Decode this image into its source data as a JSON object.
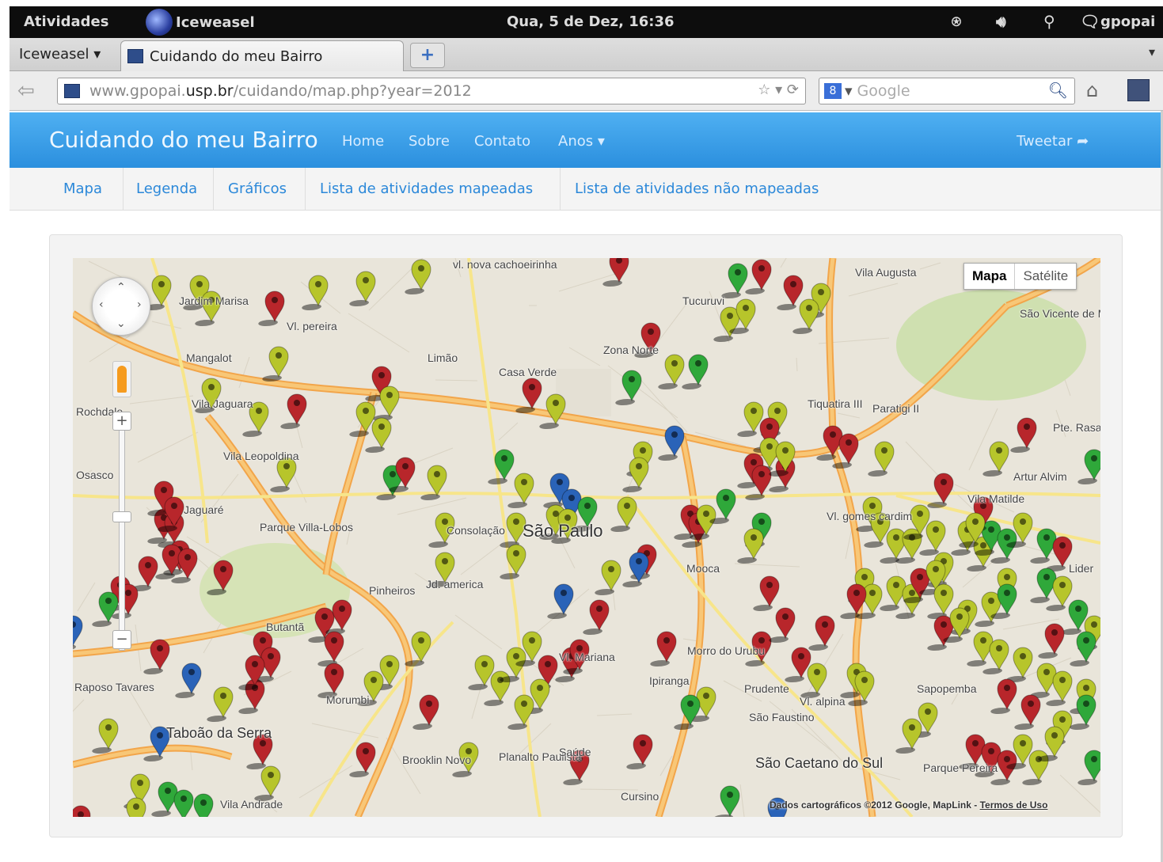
{
  "topbar": {
    "activities": "Atividades",
    "app_name": "Iceweasel",
    "clock": "Qua,  5 de Dez, 16:36",
    "user": "gpopai"
  },
  "browser": {
    "app_menu": "Iceweasel",
    "tab_title": "Cuidando do meu Bairro",
    "url_prefix": "www.gpopai.",
    "url_domain": "usp.br",
    "url_path": "/cuidando/map.php?year=2012",
    "search_placeholder": "Google"
  },
  "site": {
    "brand": "Cuidando do meu Bairro",
    "nav": [
      "Home",
      "Sobre",
      "Contato",
      "Anos"
    ],
    "tweet": "Tweetar",
    "subnav": [
      "Mapa",
      "Legenda",
      "Gráficos",
      "Lista de atividades mapeadas",
      "Lista de atividades não mapeadas"
    ]
  },
  "map": {
    "type_map": "Mapa",
    "type_satellite": "Satélite",
    "attribution": "Dados cartográficos ©2012 Google, MapLink -",
    "terms": "Termos de Uso",
    "labels": [
      {
        "t": "vl. nova cachoeirinha",
        "cls": ""
      },
      {
        "t": "Vila Augusta",
        "cls": ""
      },
      {
        "t": "Tucuruvi",
        "cls": ""
      },
      {
        "t": "Mangalot",
        "cls": ""
      },
      {
        "t": "Limão",
        "cls": ""
      },
      {
        "t": "Casa Verde",
        "cls": ""
      },
      {
        "t": "Zona Norte",
        "cls": ""
      },
      {
        "t": "Tiquatira III",
        "cls": ""
      },
      {
        "t": "Paratigi II",
        "cls": ""
      },
      {
        "t": "Vila Leopoldina",
        "cls": ""
      },
      {
        "t": "São Paulo",
        "cls": "big"
      },
      {
        "t": "Consolação",
        "cls": ""
      },
      {
        "t": "Pinheiros",
        "cls": ""
      },
      {
        "t": "Jd. america",
        "cls": ""
      },
      {
        "t": "Mooca",
        "cls": ""
      },
      {
        "t": "Vl. gomes cardim",
        "cls": ""
      },
      {
        "t": "Artur Alvim",
        "cls": ""
      },
      {
        "t": "Butantã",
        "cls": ""
      },
      {
        "t": "Morumbi",
        "cls": ""
      },
      {
        "t": "Ipiranga",
        "cls": ""
      },
      {
        "t": "Morro do Urubu",
        "cls": ""
      },
      {
        "t": "Prudente",
        "cls": ""
      },
      {
        "t": "Vl. alpina",
        "cls": ""
      },
      {
        "t": "Taboão da Serra",
        "cls": "city"
      },
      {
        "t": "Brooklin Novo",
        "cls": ""
      },
      {
        "t": "Planalto Paulista",
        "cls": ""
      },
      {
        "t": "São Caetano do Sul",
        "cls": "city"
      },
      {
        "t": "Parque Pereira",
        "cls": ""
      },
      {
        "t": "Sapopemba",
        "cls": ""
      },
      {
        "t": "Raposo Tavares",
        "cls": ""
      },
      {
        "t": "Vila Andrade",
        "cls": ""
      },
      {
        "t": "Cursino",
        "cls": ""
      },
      {
        "t": "São Faustino",
        "cls": ""
      },
      {
        "t": "Osasco",
        "cls": ""
      },
      {
        "t": "Jaguaré",
        "cls": ""
      },
      {
        "t": "Parque Villa-Lobos",
        "cls": ""
      },
      {
        "t": "Rochdale",
        "cls": ""
      },
      {
        "t": "Vl. pereira",
        "cls": ""
      },
      {
        "t": "Lider",
        "cls": ""
      },
      {
        "t": "Pte. Rasa",
        "cls": ""
      },
      {
        "t": "Vila Matilde",
        "cls": ""
      },
      {
        "t": "São Vicente de Minas I",
        "cls": ""
      },
      {
        "t": "Vila Jaguara",
        "cls": ""
      },
      {
        "t": "Jardim Marisa",
        "cls": ""
      },
      {
        "t": "Saúde",
        "cls": ""
      },
      {
        "t": "Vl. Mariana",
        "cls": ""
      }
    ],
    "legend_colors": {
      "lime": "#b7c52b",
      "red": "#b8262b",
      "green": "#2fa83a",
      "blue": "#2a63b8"
    }
  }
}
